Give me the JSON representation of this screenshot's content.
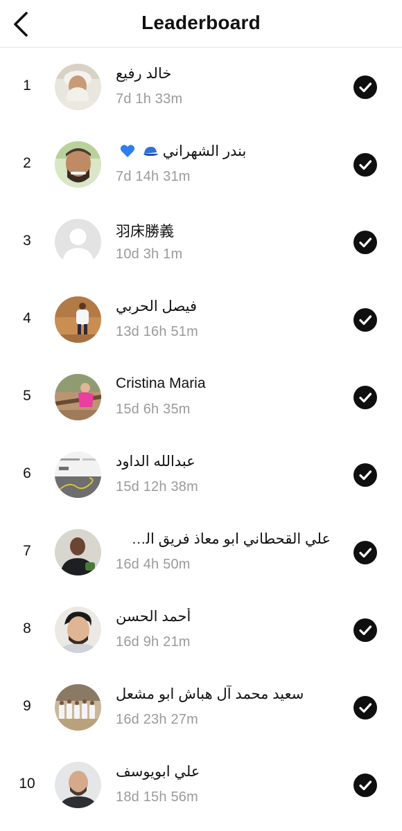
{
  "header": {
    "title": "Leaderboard",
    "back_icon": "chevron-left-icon"
  },
  "entries": [
    {
      "rank": "1",
      "name": "خالد رفيع",
      "time": "7d 1h 33m",
      "avatar": "bearded-elder-avatar",
      "status_icon": "check-circle-icon"
    },
    {
      "rank": "2",
      "name": "بندر الشهراني",
      "time": "7d 14h 31m",
      "avatar": "smiling-man-avatar",
      "status_icon": "check-circle-icon",
      "name_emojis": [
        "blue-cap-icon",
        "blue-heart-icon"
      ]
    },
    {
      "rank": "3",
      "name": "羽床勝義",
      "time": "10d 3h 1m",
      "avatar": "default-person-avatar",
      "status_icon": "check-circle-icon"
    },
    {
      "rank": "4",
      "name": "فيصل الحربي",
      "time": "13d 16h 51m",
      "avatar": "outdoor-runner-avatar",
      "status_icon": "check-circle-icon"
    },
    {
      "rank": "5",
      "name": "Cristina Maria",
      "time": "15d 6h 35m",
      "avatar": "pink-runner-avatar",
      "status_icon": "check-circle-icon"
    },
    {
      "rank": "6",
      "name": "عبدالله الداود",
      "time": "15d 12h 38m",
      "avatar": "route-map-avatar",
      "status_icon": "check-circle-icon"
    },
    {
      "rank": "7",
      "name": "علي القحطاني ابو معاذ فريق الش...",
      "time": "16d 4h 50m",
      "avatar": "man-dark-shirt-avatar",
      "status_icon": "check-circle-icon"
    },
    {
      "rank": "8",
      "name": "أحمد الحسن",
      "time": "16d 9h 21m",
      "avatar": "young-man-avatar",
      "status_icon": "check-circle-icon"
    },
    {
      "rank": "9",
      "name": "سعيد محمد آل هباش   ابو مشعل",
      "time": "16d 23h 27m",
      "avatar": "group-photo-avatar",
      "status_icon": "check-circle-icon"
    },
    {
      "rank": "10",
      "name": "علي ابويوسف",
      "time": "18d 15h 56m",
      "avatar": "man-beard-avatar",
      "status_icon": "check-circle-icon"
    }
  ],
  "colors": {
    "text": "#111111",
    "time": "#9a9a9a",
    "check_bg": "#0f0f0f",
    "divider": "#e6e6e6"
  }
}
